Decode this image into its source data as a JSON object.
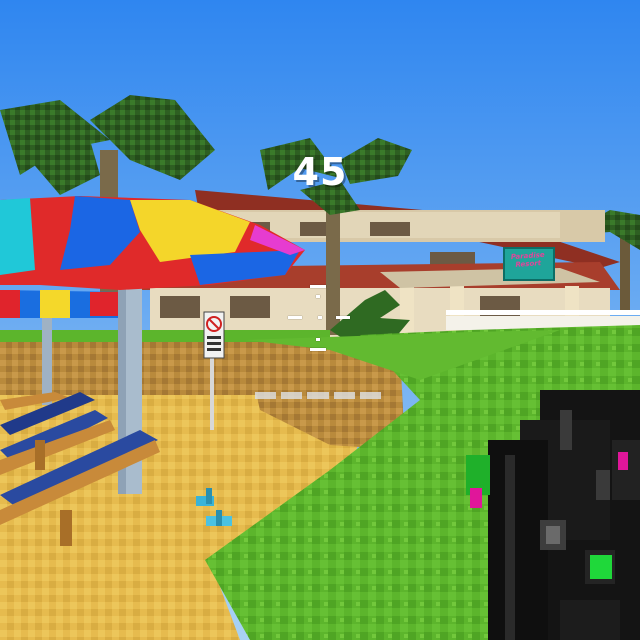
{
  "hud": {
    "counter": "45",
    "crosshair": "crosshair-icon",
    "ammo_segments": 5
  },
  "scene": {
    "building_sign": "Paradise Resort",
    "no_swimming_sign": "no-swimming-icon"
  },
  "colors": {
    "sky": "#3a8ef0",
    "grass": "#58b32a",
    "sand": "#e4b94c",
    "roof": "#a83e2c",
    "weapon": "#151515",
    "weapon_accent_green": "#1fd83a",
    "weapon_accent_pink": "#e0169a"
  }
}
